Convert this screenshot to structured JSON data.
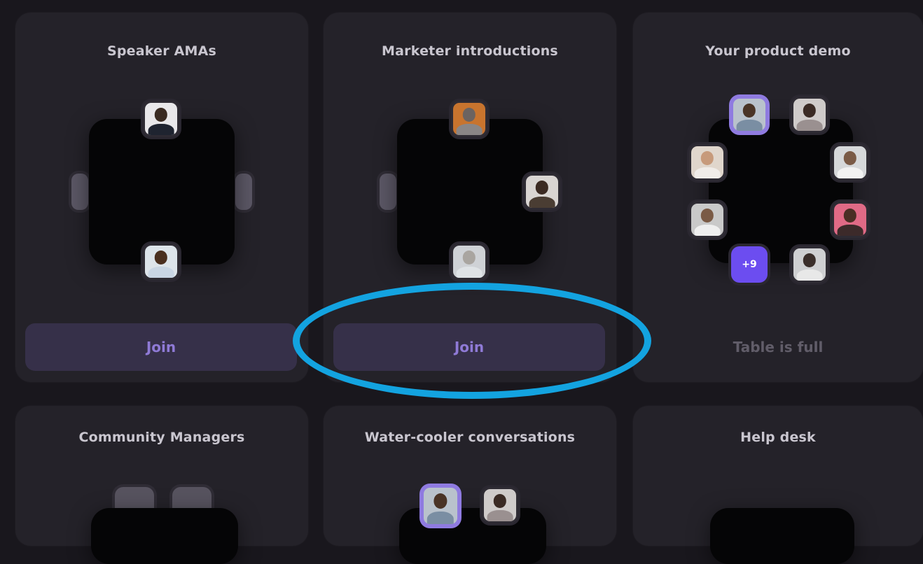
{
  "tables": [
    {
      "title": "Speaker AMAs",
      "action": "Join"
    },
    {
      "title": "Marketer introductions",
      "action": "Join"
    },
    {
      "title": "Your product demo",
      "status": "Table is full",
      "overflow_count": "+9"
    },
    {
      "title": "Community Managers"
    },
    {
      "title": "Water-cooler conversations"
    },
    {
      "title": "Help desk"
    }
  ],
  "colors": {
    "background": "#19171d",
    "card": "#242229",
    "table": "#050506",
    "join_button": "#363049",
    "join_text": "#8f7ad6",
    "overflow_badge": "#6c4df0",
    "annotation": "#13a3e0"
  }
}
